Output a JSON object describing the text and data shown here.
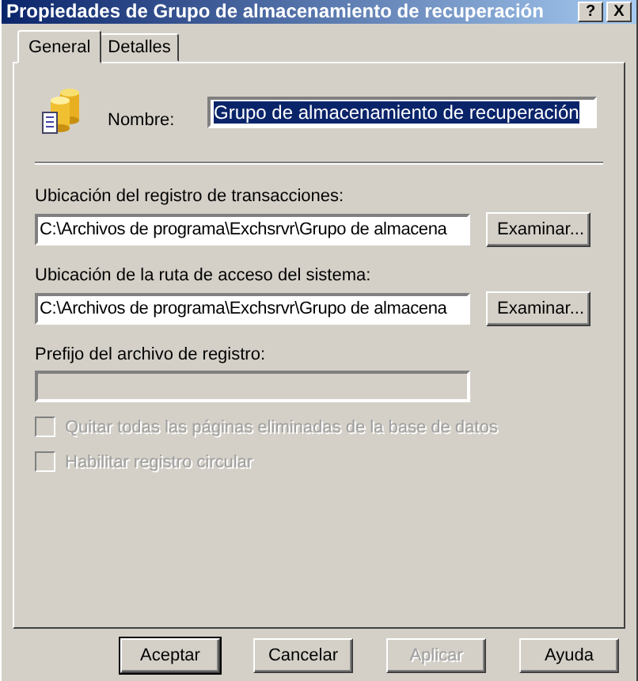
{
  "window": {
    "title": "Propiedades de Grupo de almacenamiento de recuperación",
    "help_button": "?",
    "close_button": "X"
  },
  "tabs": [
    {
      "label": "General",
      "selected": true
    },
    {
      "label": "Detalles",
      "selected": false
    }
  ],
  "name": {
    "label": "Nombre:",
    "value": "Grupo de almacenamiento de recuperación",
    "highlighted": true
  },
  "paths": [
    {
      "label": "Ubicación del registro de transacciones:",
      "value": "C:\\Archivos de programa\\Exchsrvr\\Grupo de almacena",
      "button": "Examinar..."
    },
    {
      "label": "Ubicación de la ruta de acceso del sistema:",
      "value": "C:\\Archivos de programa\\Exchsrvr\\Grupo de almacena",
      "button": "Examinar..."
    }
  ],
  "prefix": {
    "label": "Prefijo del archivo de registro:",
    "disabled": true
  },
  "checkboxes": [
    {
      "label": "Quitar todas las páginas eliminadas de la base de datos",
      "checked": false,
      "disabled": true
    },
    {
      "label": "Habilitar registro circular",
      "checked": false,
      "disabled": true
    }
  ],
  "buttons": [
    {
      "label": "Aceptar",
      "default": true,
      "disabled": false
    },
    {
      "label": "Cancelar",
      "default": false,
      "disabled": false
    },
    {
      "label": "Aplicar",
      "default": false,
      "disabled": true
    },
    {
      "label": "Ayuda",
      "default": false,
      "disabled": false
    }
  ]
}
